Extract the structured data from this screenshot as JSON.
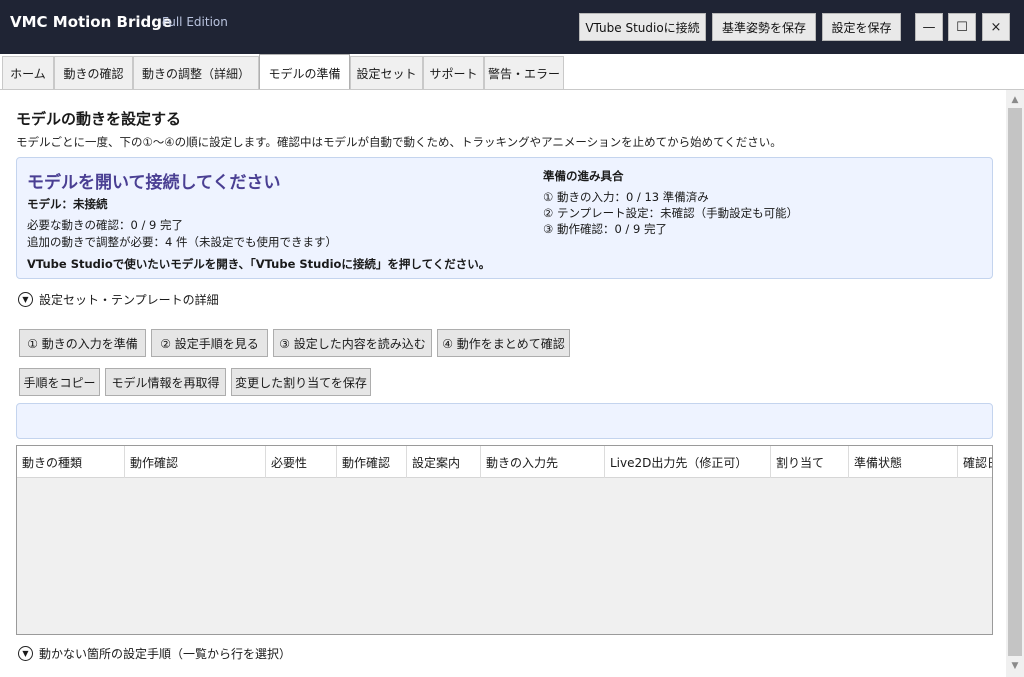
{
  "app": {
    "title": "VMC Motion Bridge",
    "edition": "Full Edition"
  },
  "toolbar": {
    "connect_label": "VTube Studioに接続",
    "save_pose_label": "基準姿勢を保存",
    "save_settings_label": "設定を保存"
  },
  "window": {
    "minimize": "—",
    "maximize": "☐",
    "close": "×"
  },
  "tabs": [
    {
      "label": "ホーム"
    },
    {
      "label": "動きの確認"
    },
    {
      "label": "動きの調整（詳細）"
    },
    {
      "label": "モデルの準備",
      "active": true
    },
    {
      "label": "設定セット"
    },
    {
      "label": "サポート"
    },
    {
      "label": "警告・エラー"
    }
  ],
  "main": {
    "title": "モデルの動きを設定する",
    "description": "モデルごとに一度、下の①〜④の順に設定します。確認中はモデルが自動で動くため、トラッキングやアニメーションを止めてから始めてください。"
  },
  "status": {
    "heading": "モデルを開いて接続してください",
    "model_line": "モデル：未接続",
    "required_line": "必要な動きの確認：0 / 9 完了",
    "additional_line": "追加の動きで調整が必要：4 件（未設定でも使用できます）",
    "instruction": "VTube Studioで使いたいモデルを開き、「VTube Studioに接続」を押してください。",
    "progress_title": "準備の進み具合",
    "progress": [
      "① 動きの入力：0 / 13 準備済み",
      "② テンプレート設定：未確認（手動設定も可能）",
      "③ 動作確認：0 / 9 完了"
    ]
  },
  "expander_templates": "設定セット・テンプレートの詳細",
  "actions": {
    "step1": "① 動きの入力を準備",
    "step2": "② 設定手順を見る",
    "step3": "③ 設定した内容を読み込む",
    "step4": "④ 動作をまとめて確認",
    "copy_steps": "手順をコピー",
    "reload_model": "モデル情報を再取得",
    "save_assignments": "変更した割り当てを保存"
  },
  "table": {
    "columns": [
      "動きの種類",
      "動作確認",
      "必要性",
      "動作確認",
      "設定案内",
      "動きの入力先",
      "Live2D出力先（修正可）",
      "割り当て",
      "準備状態",
      "確認日"
    ]
  },
  "expander_unmoving": "動かない箇所の設定手順（一覧から行を選択）",
  "icons": {
    "expand": "chevron-down-icon",
    "scroll_up": "▲",
    "scroll_down": "▼"
  }
}
